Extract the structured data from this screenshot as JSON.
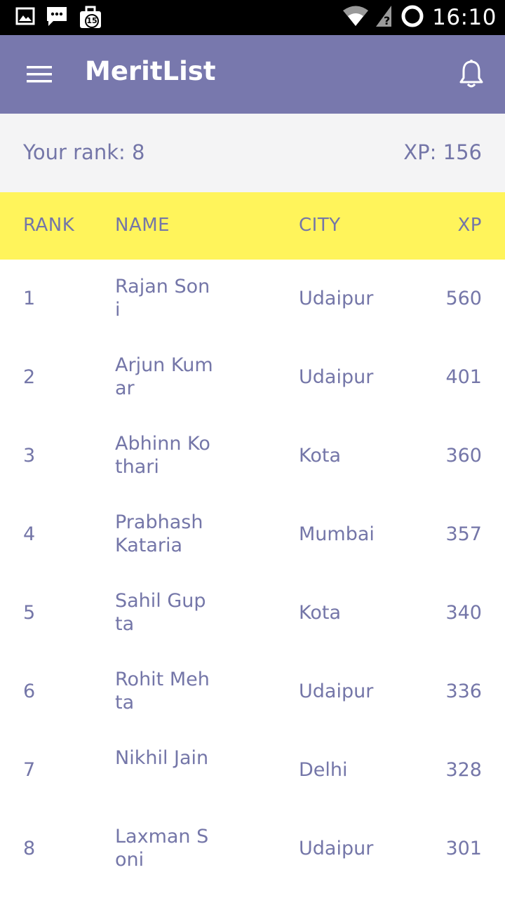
{
  "status_bar": {
    "time": "16:10",
    "notification_badge": "15",
    "icons": [
      "image-icon",
      "chat-icon",
      "briefcase-icon",
      "wifi-icon",
      "signal-unknown-icon",
      "battery-ring-icon"
    ]
  },
  "app_bar": {
    "title": "MeritList",
    "color": "#7878ad"
  },
  "summary": {
    "rank_text": "Your rank: 8",
    "xp_text": "XP: 156"
  },
  "table": {
    "header_color": "#fff45b",
    "columns": {
      "rank": "RANK",
      "name": "NAME",
      "city": "CITY",
      "xp": "XP"
    },
    "rows": [
      {
        "rank": "1",
        "name": "Rajan Soni",
        "city": "Udaipur",
        "xp": "560"
      },
      {
        "rank": "2",
        "name": "Arjun Kumar",
        "city": "Udaipur",
        "xp": "401"
      },
      {
        "rank": "3",
        "name": "Abhinn Kothari",
        "city": "Kota",
        "xp": "360"
      },
      {
        "rank": "4",
        "name": "Prabhash Kataria",
        "city": "Mumbai",
        "xp": "357"
      },
      {
        "rank": "5",
        "name": "Sahil Gupta",
        "city": "Kota",
        "xp": "340"
      },
      {
        "rank": "6",
        "name": "Rohit Mehta",
        "city": "Udaipur",
        "xp": "336"
      },
      {
        "rank": "7",
        "name": "Nikhil Jain",
        "city": "Delhi",
        "xp": "328"
      },
      {
        "rank": "8",
        "name": "Laxman Soni",
        "city": "Udaipur",
        "xp": "301"
      }
    ]
  }
}
